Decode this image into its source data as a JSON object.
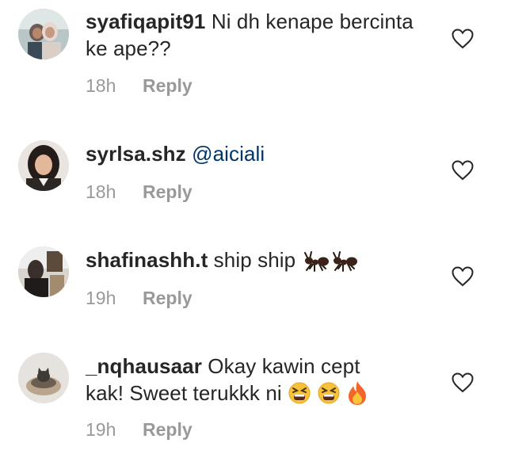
{
  "comments": [
    {
      "username": "syafiqapit91",
      "text": "Ni dh kenape bercinta ke ape??",
      "time": "18h",
      "reply": "Reply",
      "avatar": "couple-photo",
      "like_icon": "heart-outline-icon"
    },
    {
      "username": "syrlsa.shz",
      "mention": "@aiciali",
      "text": "",
      "time": "18h",
      "reply": "Reply",
      "avatar": "girl-portrait",
      "like_icon": "heart-outline-icon"
    },
    {
      "username": "shafinashh.t",
      "text": "ship ship",
      "emojis": [
        "ant-emoji",
        "ant-emoji"
      ],
      "time": "19h",
      "reply": "Reply",
      "avatar": "outdoor-photo",
      "like_icon": "heart-outline-icon"
    },
    {
      "username": "_nqhausaar",
      "text_line1": "Okay kawin cept",
      "text_line2": "kak! Sweet terukkk ni",
      "emojis": [
        "tired-face-emoji",
        "tired-face-emoji",
        "fire-emoji"
      ],
      "time": "19h",
      "reply": "Reply",
      "avatar": "cat-photo",
      "like_icon": "heart-outline-icon"
    }
  ],
  "colors": {
    "username": "#262626",
    "mention": "#003569",
    "meta": "#999999"
  }
}
